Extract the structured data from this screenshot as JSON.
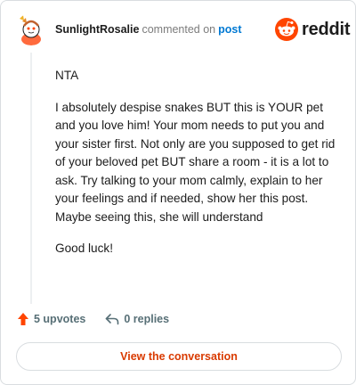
{
  "header": {
    "username": "SunlightRosalie",
    "action_text": "commented on",
    "post_link": "post",
    "brand": "reddit"
  },
  "comment": {
    "paragraphs": [
      "NTA",
      "I absolutely despise snakes BUT this is YOUR pet and you love him! Your mom needs to put you and your sister first. Not only are you supposed to get rid of your beloved pet BUT share a room - it is a lot to ask. Try talking to your mom calmly, explain to her your feelings and if needed, show her this post. Maybe seeing this, she will understand",
      "Good luck!"
    ]
  },
  "actions": {
    "upvotes": "5 upvotes",
    "replies": "0 replies"
  },
  "footer": {
    "button_label": "View the conversation"
  },
  "colors": {
    "brand_orange": "#ff4500",
    "link_blue": "#0079d3",
    "button_text": "#d93a00",
    "upvote_icon": "#ff4500"
  },
  "icons": [
    "avatar-icon",
    "reddit-snoo-icon",
    "upvote-arrow-icon",
    "reply-arrow-icon"
  ]
}
